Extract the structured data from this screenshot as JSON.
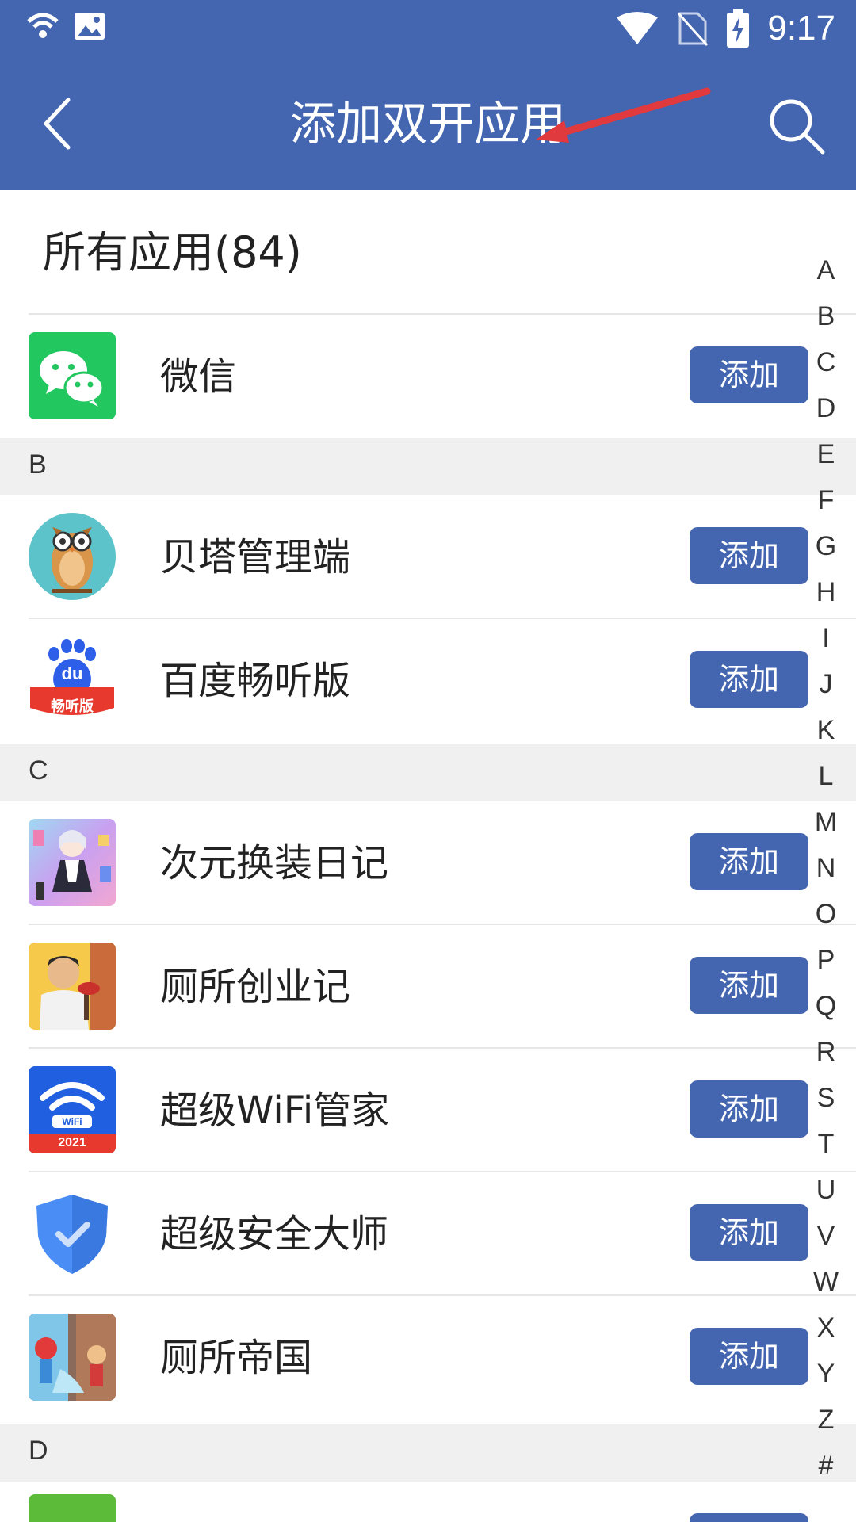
{
  "status": {
    "time": "9:17"
  },
  "appbar": {
    "title": "添加双开应用"
  },
  "section": {
    "title": "所有应用(84)"
  },
  "add_label": "添加",
  "apps": [
    {
      "name": "微信",
      "icon": "wechat-icon"
    },
    {
      "name": "贝塔管理端",
      "icon": "owl-icon"
    },
    {
      "name": "百度畅听版",
      "icon": "baidu-icon",
      "icon_text": "畅听版",
      "icon_du": "du"
    },
    {
      "name": "次元换装日记",
      "icon": "dressup-icon"
    },
    {
      "name": "厕所创业记",
      "icon": "man-plunger-icon"
    },
    {
      "name": "超级WiFi管家",
      "icon": "wifi-icon",
      "icon_text": "WiFi",
      "icon_year": "2021"
    },
    {
      "name": "超级安全大师",
      "icon": "shield-icon"
    },
    {
      "name": "厕所帝国",
      "icon": "toilet-empire-icon"
    }
  ],
  "headers": [
    "B",
    "C",
    "D"
  ],
  "index_letters": [
    "A",
    "B",
    "C",
    "D",
    "E",
    "F",
    "G",
    "H",
    "I",
    "J",
    "K",
    "L",
    "M",
    "N",
    "O",
    "P",
    "Q",
    "R",
    "S",
    "T",
    "U",
    "V",
    "W",
    "X",
    "Y",
    "Z",
    "#"
  ],
  "colors": {
    "primary": "#4466b0",
    "annotation_arrow": "#e0393e"
  }
}
